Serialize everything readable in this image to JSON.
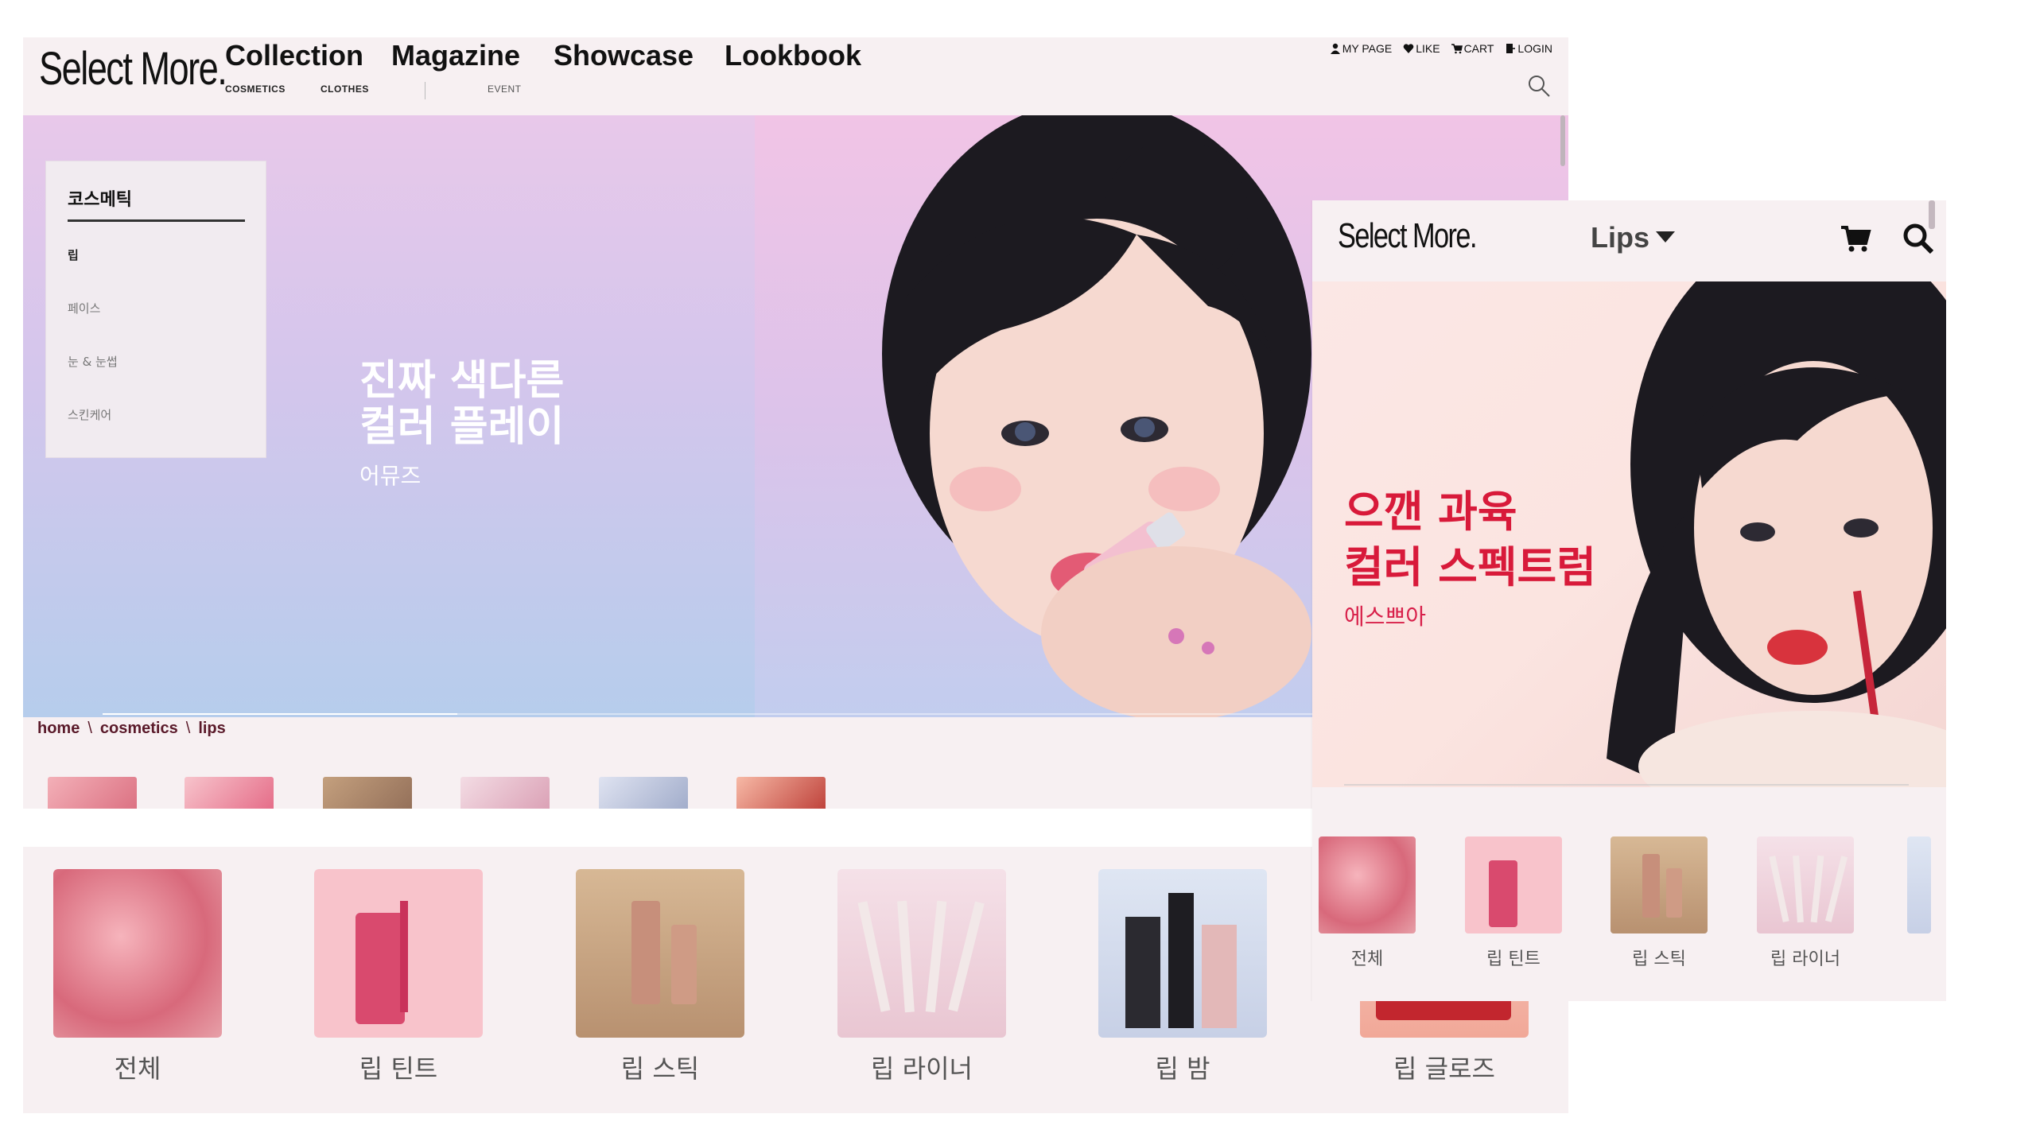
{
  "desktop": {
    "logo": "Select More.",
    "nav": [
      {
        "label": "Collection"
      },
      {
        "label": "Magazine"
      },
      {
        "label": "Showcase"
      },
      {
        "label": "Lookbook"
      }
    ],
    "subnav": {
      "cosmetics": "COSMETICS",
      "clothes": "CLOTHES",
      "event": "EVENT"
    },
    "utility": {
      "mypage": "MY PAGE",
      "like": "LIKE",
      "cart": "CART",
      "login": "LOGIN"
    },
    "side_menu": {
      "title": "코스메틱",
      "items": [
        "립",
        "페이스",
        "눈 & 눈썹",
        "스킨케어"
      ]
    },
    "hero": {
      "title_line1": "진짜 색다른",
      "title_line2": "컬러 플레이",
      "brand": "어뮤즈",
      "progress": 0.27
    },
    "breadcrumb": [
      "home",
      "cosmetics",
      "lips"
    ],
    "breadcrumb_sep": "\\",
    "categories": [
      "전체",
      "립 틴트",
      "립 스틱",
      "립 라이너",
      "립 밤",
      "립 글로즈"
    ]
  },
  "mobile": {
    "logo": "Select More.",
    "dropdown_label": "Lips",
    "hero": {
      "title_line1": "으깬 과육",
      "title_line2": "컬러 스펙트럼",
      "brand": "에스쁘아"
    },
    "categories": [
      "전체",
      "립 틴트",
      "립 스틱",
      "립 라이너"
    ]
  },
  "colors": {
    "background": "#f7f0f2",
    "breadcrumb": "#5a1a2a",
    "mobile_hero_text": "#d81a3a"
  }
}
